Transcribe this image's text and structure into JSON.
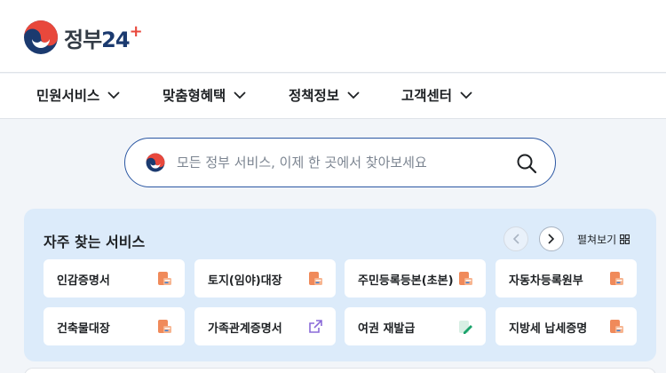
{
  "brand": {
    "name": "정부",
    "number": "24",
    "plus": "+"
  },
  "nav": {
    "items": [
      {
        "label": "민원서비스"
      },
      {
        "label": "맞춤형혜택"
      },
      {
        "label": "정책정보"
      },
      {
        "label": "고객센터"
      }
    ]
  },
  "search": {
    "placeholder": "모든 정부 서비스, 이제 한 곳에서 찾아보세요",
    "value": ""
  },
  "frequent": {
    "title": "자주 찾는 서비스",
    "expand_label": "펼쳐보기",
    "items": [
      {
        "label": "인감증명서",
        "icon": "document-icon"
      },
      {
        "label": "토지(임야)대장",
        "icon": "document-icon"
      },
      {
        "label": "주민등록등본(초본)",
        "icon": "document-icon"
      },
      {
        "label": "자동차등록원부",
        "icon": "document-icon"
      },
      {
        "label": "건축물대장",
        "icon": "document-icon"
      },
      {
        "label": "가족관계증명서",
        "icon": "external-link-icon"
      },
      {
        "label": "여권 재발급",
        "icon": "edit-document-icon"
      },
      {
        "label": "지방세 납세증명",
        "icon": "document-icon"
      }
    ]
  },
  "colors": {
    "brand_blue": "#1b3a6f",
    "brand_red": "#e8483c",
    "search_border": "#2b57a3",
    "panel_bg": "#dcebfa",
    "doc_orange": "#f08a5a",
    "link_purple": "#8a6ad8",
    "edit_green": "#1aa36b"
  }
}
